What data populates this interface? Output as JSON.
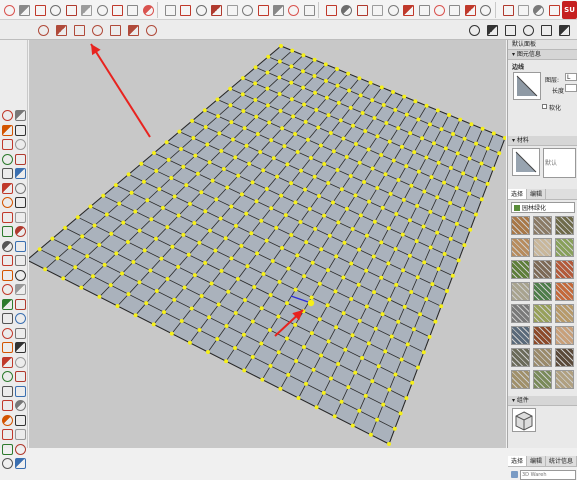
{
  "toolbar": {
    "su_badge": "SU",
    "top_icons": [
      "select-icon",
      "eraser-icon",
      "paint-icon",
      "line-icon",
      "rectangle-icon",
      "circle-icon",
      "arc-icon",
      "polygon-icon",
      "freehand-icon",
      "move-icon",
      "push-pull-icon",
      "rotate-icon",
      "follow-me-icon",
      "scale-icon",
      "offset-icon",
      "tape-icon",
      "dimension-icon",
      "protractor-icon",
      "text-icon",
      "axes-icon",
      "3d-text-icon",
      "orbit-icon",
      "pan-icon",
      "zoom-icon",
      "zoom-window-icon",
      "zoom-extents-icon",
      "previous-icon",
      "next-icon",
      "position-camera-icon",
      "walk-icon",
      "look-around-icon",
      "section-icon",
      "warehouse-icon",
      "extension-icon",
      "ruby-icon"
    ],
    "second_row_icons": [
      "xray-icon",
      "back-edges-icon",
      "wireframe-icon",
      "hidden-line-icon",
      "shaded-icon",
      "shaded-textures-icon",
      "monochrome-icon"
    ],
    "view_icons": [
      "iso-icon",
      "top-icon",
      "front-icon",
      "right-icon",
      "back-icon",
      "left-icon"
    ]
  },
  "tray": {
    "title": "默认面板",
    "entity_info": {
      "header": "图元信息",
      "type": "边线",
      "layer_label": "图层:",
      "layer_value": "L",
      "length_label": "长度",
      "softened_label": "软化"
    },
    "materials": {
      "header": "材料",
      "name_placeholder": "默认",
      "tabs": [
        "选择",
        "编辑"
      ],
      "collection": "园林绿化"
    },
    "components": {
      "header": "组件",
      "tabs": [
        "选择",
        "编辑",
        "统计信息"
      ],
      "search_placeholder": "3D Wareh"
    }
  },
  "colors": {
    "grid_fill": "#aab2bc",
    "grid_edge": "#2b2b2b",
    "vertex": "#f5ef1a",
    "arrow": "#e8231f",
    "canvas": "#c8c8c8"
  }
}
